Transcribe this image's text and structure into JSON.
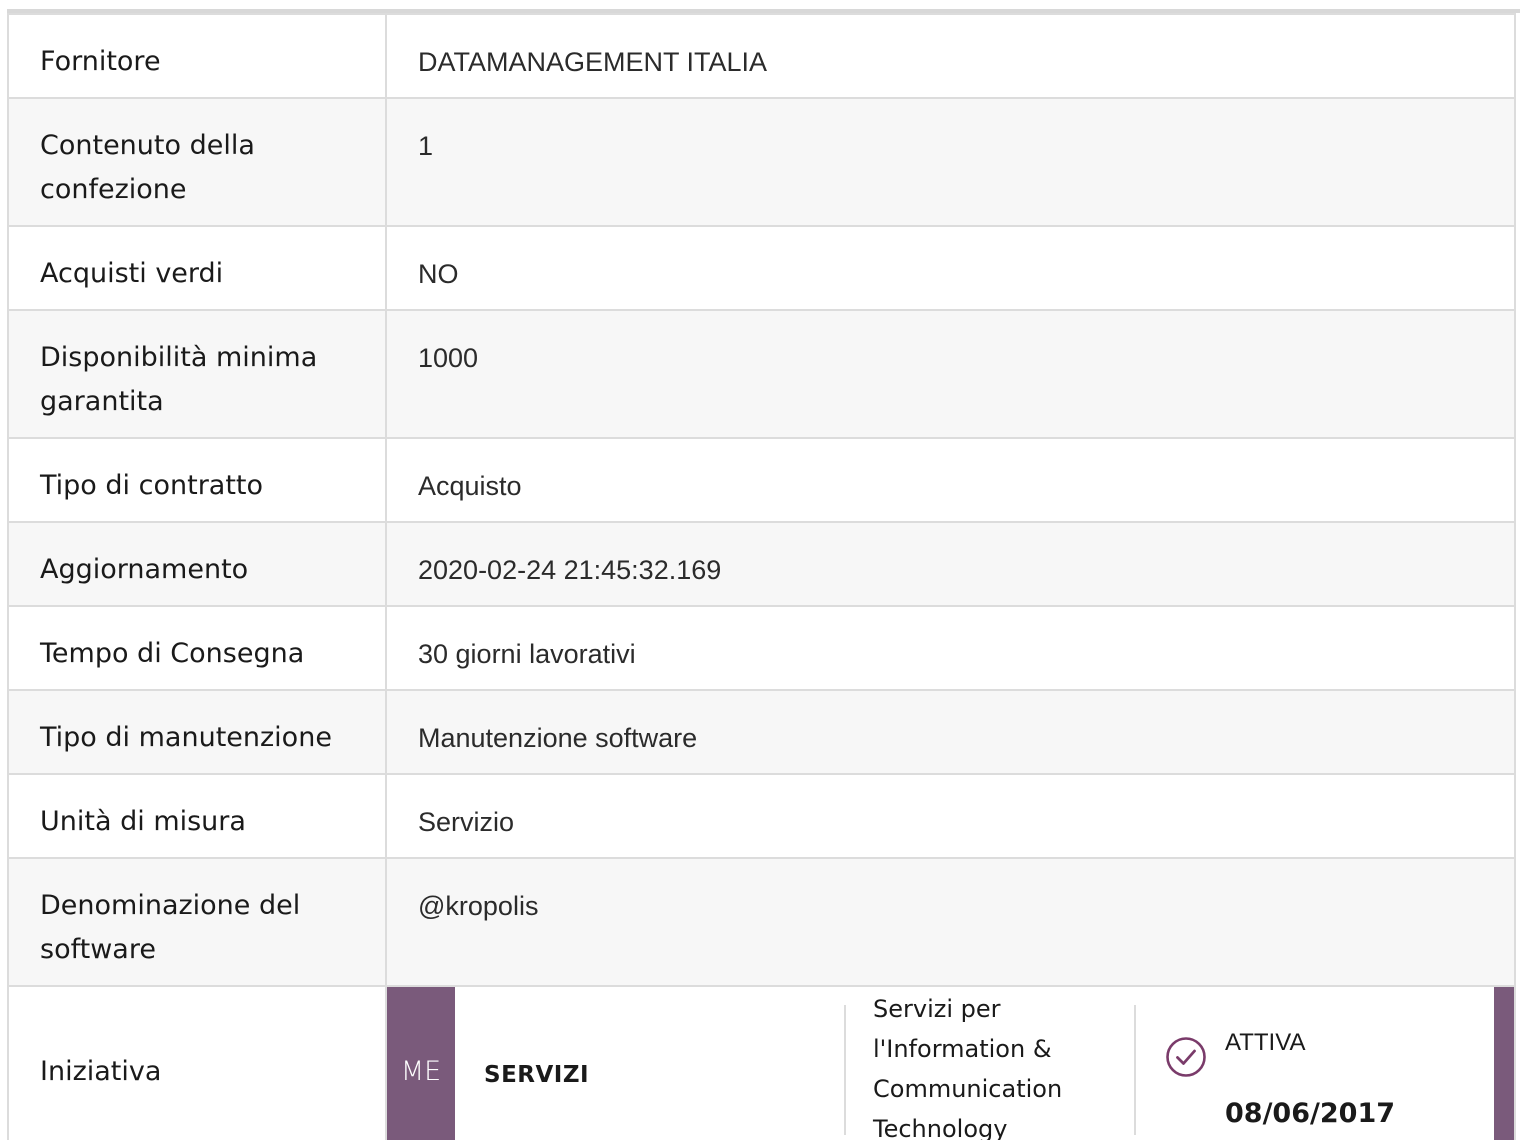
{
  "rows": [
    {
      "label": "Fornitore",
      "value": "DATAMANAGEMENT ITALIA"
    },
    {
      "label": "Contenuto della confezione",
      "value": "1"
    },
    {
      "label": "Acquisti verdi",
      "value": "NO"
    },
    {
      "label": "Disponibilità minima garantita",
      "value": "1000"
    },
    {
      "label": "Tipo di contratto",
      "value": "Acquisto"
    },
    {
      "label": "Aggiornamento",
      "value": "2020-02-24 21:45:32.169"
    },
    {
      "label": "Tempo di Consegna",
      "value": "30 giorni lavorativi"
    },
    {
      "label": "Tipo di manutenzione",
      "value": "Manutenzione software"
    },
    {
      "label": "Unità di misura",
      "value": "Servizio"
    },
    {
      "label": "Denominazione del software",
      "value": "@kropolis"
    }
  ],
  "iniziativa": {
    "label": "Iniziativa",
    "badge": "ME",
    "type": "SERVIZI",
    "description": "Servizi per l'Information & Communication Technology",
    "status": "ATTIVA",
    "date": "08/06/2017",
    "status_icon": "check-circle-icon"
  },
  "colors": {
    "accent": "#7a5a7b",
    "border": "#dcdcdc",
    "row_alt": "#f7f7f7"
  }
}
